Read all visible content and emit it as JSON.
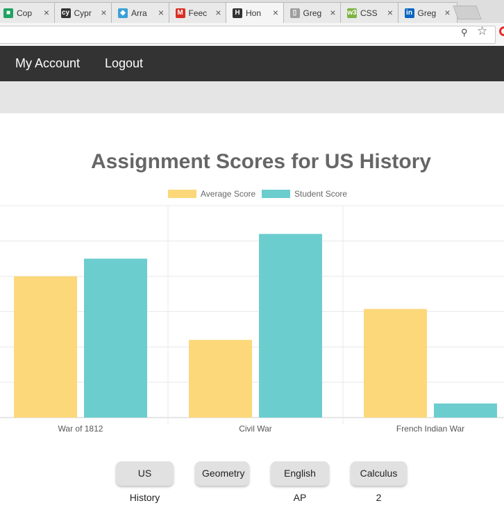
{
  "browser": {
    "tabs": [
      {
        "label": "Cop",
        "favicon": "green-doc-icon",
        "color": "#1ea362"
      },
      {
        "label": "Cypr",
        "favicon": "cypress-icon",
        "color": "#333333"
      },
      {
        "label": "Arra",
        "favicon": "duck-icon",
        "color": "#3aa0d8"
      },
      {
        "label": "Feec",
        "favicon": "gmail-icon",
        "color": "#d93025"
      },
      {
        "label": "Hon",
        "favicon": "heroku-h-icon",
        "color": "#333333"
      },
      {
        "label": "Greg",
        "favicon": "document-icon",
        "color": "#9e9e9e"
      },
      {
        "label": "CSS",
        "favicon": "w3-icon",
        "color": "#7cb342"
      },
      {
        "label": "Greg",
        "favicon": "linkedin-icon",
        "color": "#0a66c2"
      }
    ],
    "active_tab": 4
  },
  "nav": {
    "my_account": "My Account",
    "logout": "Logout"
  },
  "chart_data": {
    "type": "bar",
    "title": "Assignment Scores for US History",
    "categories": [
      "War of 1812",
      "Civil War",
      "French Indian War"
    ],
    "series": [
      {
        "name": "Average Score",
        "values": [
          80,
          44,
          61.5
        ],
        "color": "#fcd87a"
      },
      {
        "name": "Student Score",
        "values": [
          90,
          104,
          8
        ],
        "color": "#6ccdcf"
      }
    ],
    "ylim": [
      0,
      120
    ],
    "grid": true,
    "legend_position": "top"
  },
  "courses": [
    "US History",
    "Geometry",
    "English AP",
    "Calculus 2"
  ]
}
